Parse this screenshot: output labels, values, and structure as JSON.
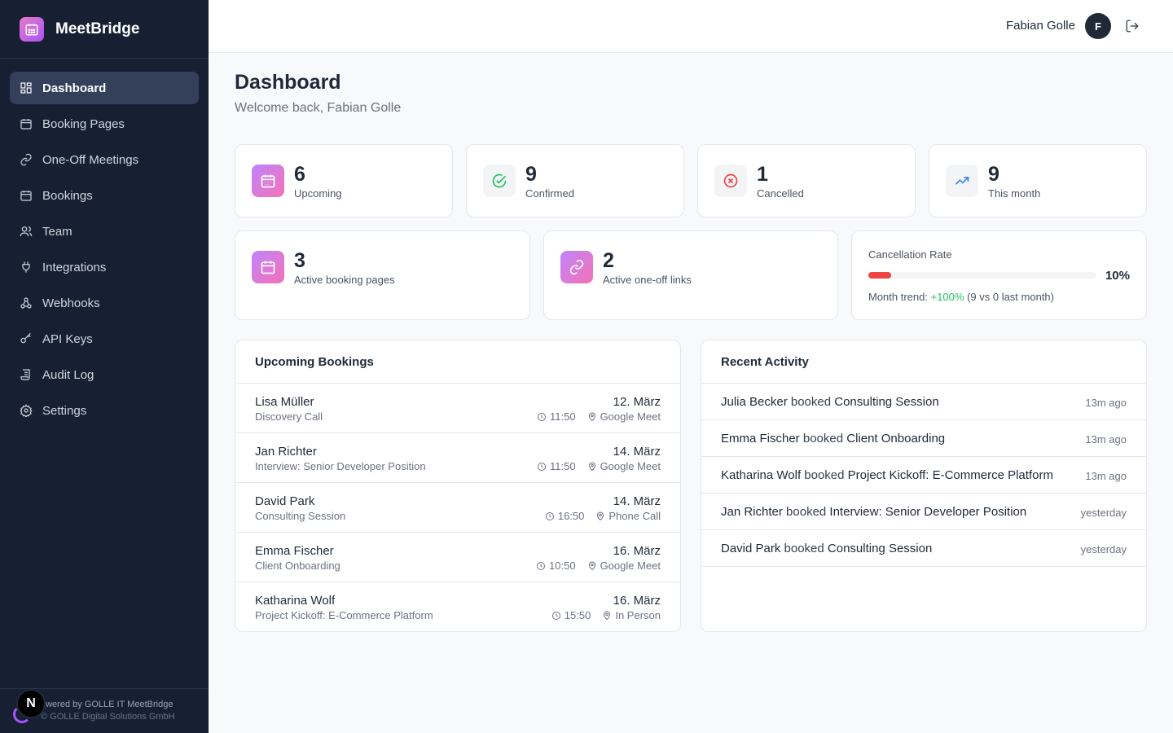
{
  "app": {
    "name": "MeetBridge"
  },
  "sidebar": {
    "items": [
      {
        "label": "Dashboard",
        "icon": "dashboard-icon",
        "active": true
      },
      {
        "label": "Booking Pages",
        "icon": "calendar-icon"
      },
      {
        "label": "One-Off Meetings",
        "icon": "link-icon"
      },
      {
        "label": "Bookings",
        "icon": "calendar-grid-icon"
      },
      {
        "label": "Team",
        "icon": "users-icon"
      },
      {
        "label": "Integrations",
        "icon": "plug-icon"
      },
      {
        "label": "Webhooks",
        "icon": "webhook-icon"
      },
      {
        "label": "API Keys",
        "icon": "key-icon"
      },
      {
        "label": "Audit Log",
        "icon": "scroll-icon"
      },
      {
        "label": "Settings",
        "icon": "gear-icon"
      }
    ],
    "footer": {
      "powered": "owered by GOLLE IT MeetBridge",
      "copyright": "© GOLLE Digital Solutions GmbH",
      "badge": "N"
    }
  },
  "header": {
    "user_name": "Fabian Golle",
    "avatar_initial": "F"
  },
  "page": {
    "title": "Dashboard",
    "subtitle": "Welcome back, Fabian Golle"
  },
  "stats": {
    "upcoming": {
      "value": "6",
      "label": "Upcoming"
    },
    "confirmed": {
      "value": "9",
      "label": "Confirmed"
    },
    "cancelled": {
      "value": "1",
      "label": "Cancelled"
    },
    "this_month": {
      "value": "9",
      "label": "This month"
    },
    "booking_pages": {
      "value": "3",
      "label": "Active booking pages"
    },
    "one_off": {
      "value": "2",
      "label": "Active one-off links"
    }
  },
  "cancellation": {
    "title": "Cancellation Rate",
    "percent_text": "10%",
    "percent": 10,
    "trend_prefix": "Month trend: ",
    "trend_value": "+100%",
    "trend_suffix": " (9 vs 0 last month)"
  },
  "upcoming_bookings": {
    "title": "Upcoming Bookings",
    "rows": [
      {
        "name": "Lisa Müller",
        "type": "Discovery Call",
        "date": "12. März",
        "time": "11:50",
        "location": "Google Meet"
      },
      {
        "name": "Jan Richter",
        "type": "Interview: Senior Developer Position",
        "date": "14. März",
        "time": "11:50",
        "location": "Google Meet"
      },
      {
        "name": "David Park",
        "type": "Consulting Session",
        "date": "14. März",
        "time": "16:50",
        "location": "Phone Call"
      },
      {
        "name": "Emma Fischer",
        "type": "Client Onboarding",
        "date": "16. März",
        "time": "10:50",
        "location": "Google Meet"
      },
      {
        "name": "Katharina Wolf",
        "type": "Project Kickoff: E-Commerce Platform",
        "date": "16. März",
        "time": "15:50",
        "location": "In Person"
      }
    ]
  },
  "recent_activity": {
    "title": "Recent Activity",
    "rows": [
      {
        "who": "Julia Becker",
        "verb": " booked ",
        "what": "Consulting Session",
        "when": "13m ago"
      },
      {
        "who": "Emma Fischer",
        "verb": " booked ",
        "what": "Client Onboarding",
        "when": "13m ago"
      },
      {
        "who": "Katharina Wolf",
        "verb": " booked ",
        "what": "Project Kickoff: E-Commerce Platform",
        "when": "13m ago"
      },
      {
        "who": "Jan Richter",
        "verb": " booked ",
        "what": "Interview: Senior Developer Position",
        "when": "yesterday"
      },
      {
        "who": "David Park",
        "verb": " booked ",
        "what": "Consulting Session",
        "when": "yesterday"
      }
    ]
  },
  "colors": {
    "sidebar": "#172033",
    "accent_start": "#c084fc",
    "accent_end": "#f472b6",
    "success": "#22c55e",
    "danger": "#ef4444"
  }
}
